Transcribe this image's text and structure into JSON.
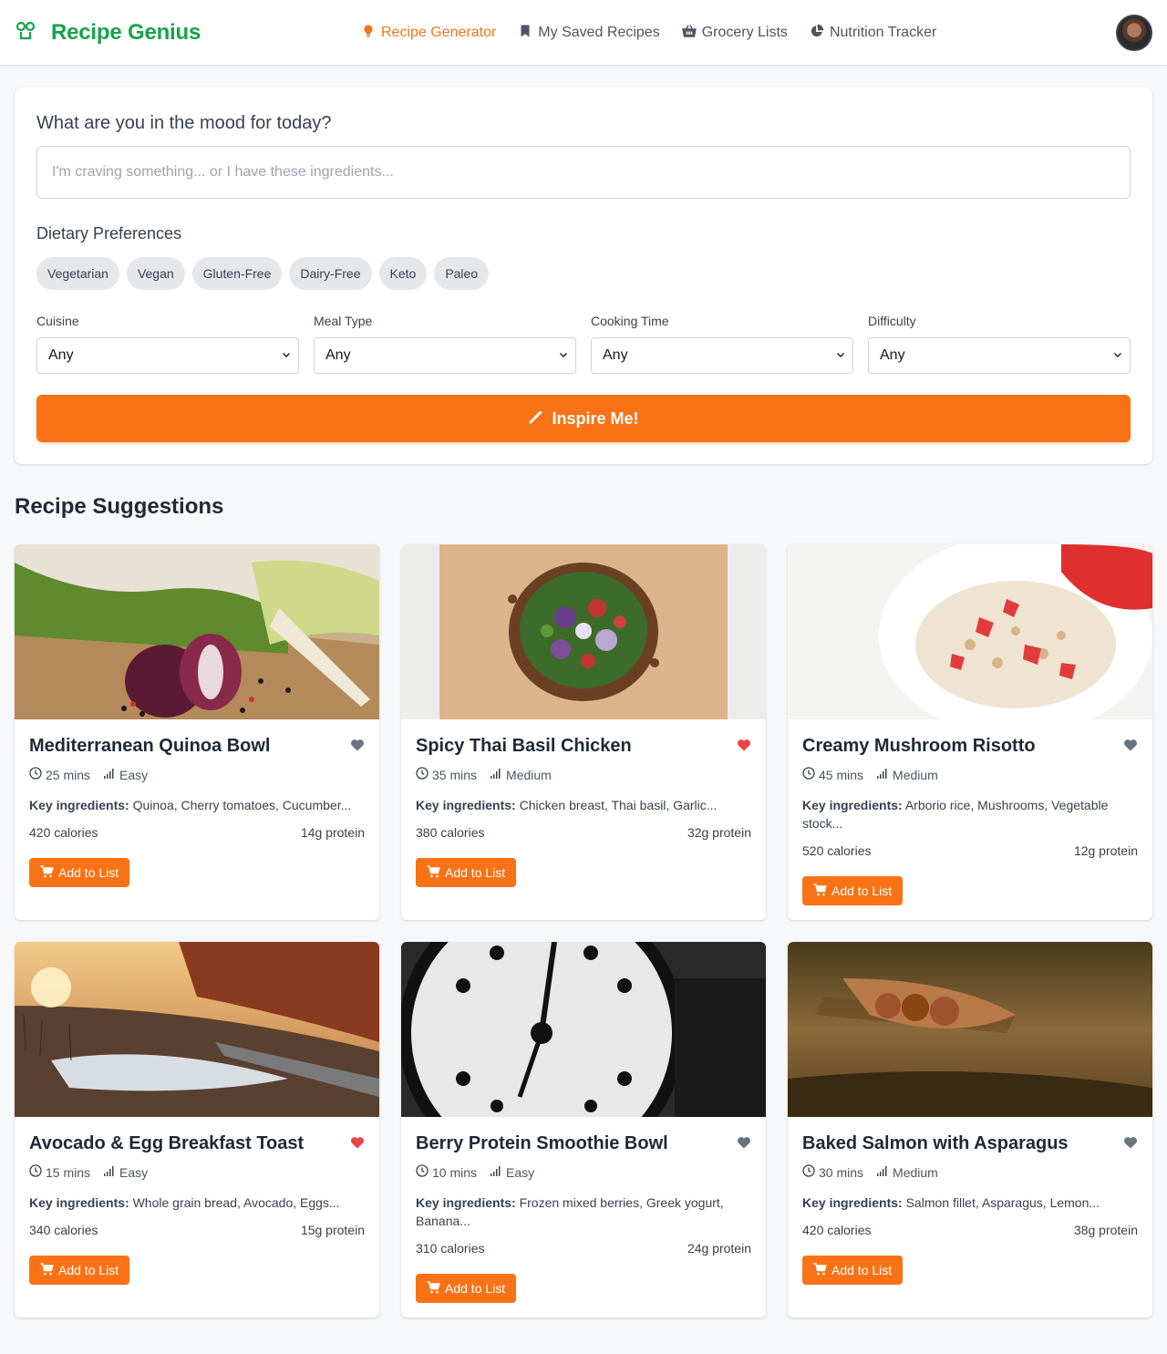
{
  "brand": {
    "name": "Recipe Genius",
    "color": "#16a34a"
  },
  "accent_color": "#f97316",
  "nav": {
    "items": [
      {
        "label": "Recipe Generator",
        "icon": "lightbulb-icon",
        "active": true
      },
      {
        "label": "My Saved Recipes",
        "icon": "bookmark-icon",
        "active": false
      },
      {
        "label": "Grocery Lists",
        "icon": "basket-icon",
        "active": false
      },
      {
        "label": "Nutrition Tracker",
        "icon": "pie-chart-icon",
        "active": false
      }
    ]
  },
  "search": {
    "question": "What are you in the mood for today?",
    "placeholder": "I'm craving something... or I have these ingredients...",
    "value": ""
  },
  "dietary": {
    "title": "Dietary Preferences",
    "chips": [
      "Vegetarian",
      "Vegan",
      "Gluten-Free",
      "Dairy-Free",
      "Keto",
      "Paleo"
    ]
  },
  "filters": [
    {
      "label": "Cuisine",
      "value": "Any"
    },
    {
      "label": "Meal Type",
      "value": "Any"
    },
    {
      "label": "Cooking Time",
      "value": "Any"
    },
    {
      "label": "Difficulty",
      "value": "Any"
    }
  ],
  "inspire_label": "Inspire Me!",
  "suggestions": {
    "title": "Recipe Suggestions",
    "cards": [
      {
        "title": "Mediterranean Quinoa Bowl",
        "favorite": false,
        "time": "25 mins",
        "difficulty": "Easy",
        "ingredients_label": "Key ingredients:",
        "ingredients": "Quinoa, Cherry tomatoes, Cucumber...",
        "calories": "420 calories",
        "protein": "14g protein",
        "button": "Add to List"
      },
      {
        "title": "Spicy Thai Basil Chicken",
        "favorite": true,
        "time": "35 mins",
        "difficulty": "Medium",
        "ingredients_label": "Key ingredients:",
        "ingredients": "Chicken breast, Thai basil, Garlic...",
        "calories": "380 calories",
        "protein": "32g protein",
        "button": "Add to List"
      },
      {
        "title": "Creamy Mushroom Risotto",
        "favorite": false,
        "time": "45 mins",
        "difficulty": "Medium",
        "ingredients_label": "Key ingredients:",
        "ingredients": "Arborio rice, Mushrooms, Vegetable stock...",
        "calories": "520 calories",
        "protein": "12g protein",
        "button": "Add to List"
      },
      {
        "title": "Avocado & Egg Breakfast Toast",
        "favorite": true,
        "time": "15 mins",
        "difficulty": "Easy",
        "ingredients_label": "Key ingredients:",
        "ingredients": "Whole grain bread, Avocado, Eggs...",
        "calories": "340 calories",
        "protein": "15g protein",
        "button": "Add to List"
      },
      {
        "title": "Berry Protein Smoothie Bowl",
        "favorite": false,
        "time": "10 mins",
        "difficulty": "Easy",
        "ingredients_label": "Key ingredients:",
        "ingredients": "Frozen mixed berries, Greek yogurt, Banana...",
        "calories": "310 calories",
        "protein": "24g protein",
        "button": "Add to List"
      },
      {
        "title": "Baked Salmon with Asparagus",
        "favorite": false,
        "time": "30 mins",
        "difficulty": "Medium",
        "ingredients_label": "Key ingredients:",
        "ingredients": "Salmon fillet, Asparagus, Lemon...",
        "calories": "420 calories",
        "protein": "38g protein",
        "button": "Add to List"
      }
    ]
  }
}
